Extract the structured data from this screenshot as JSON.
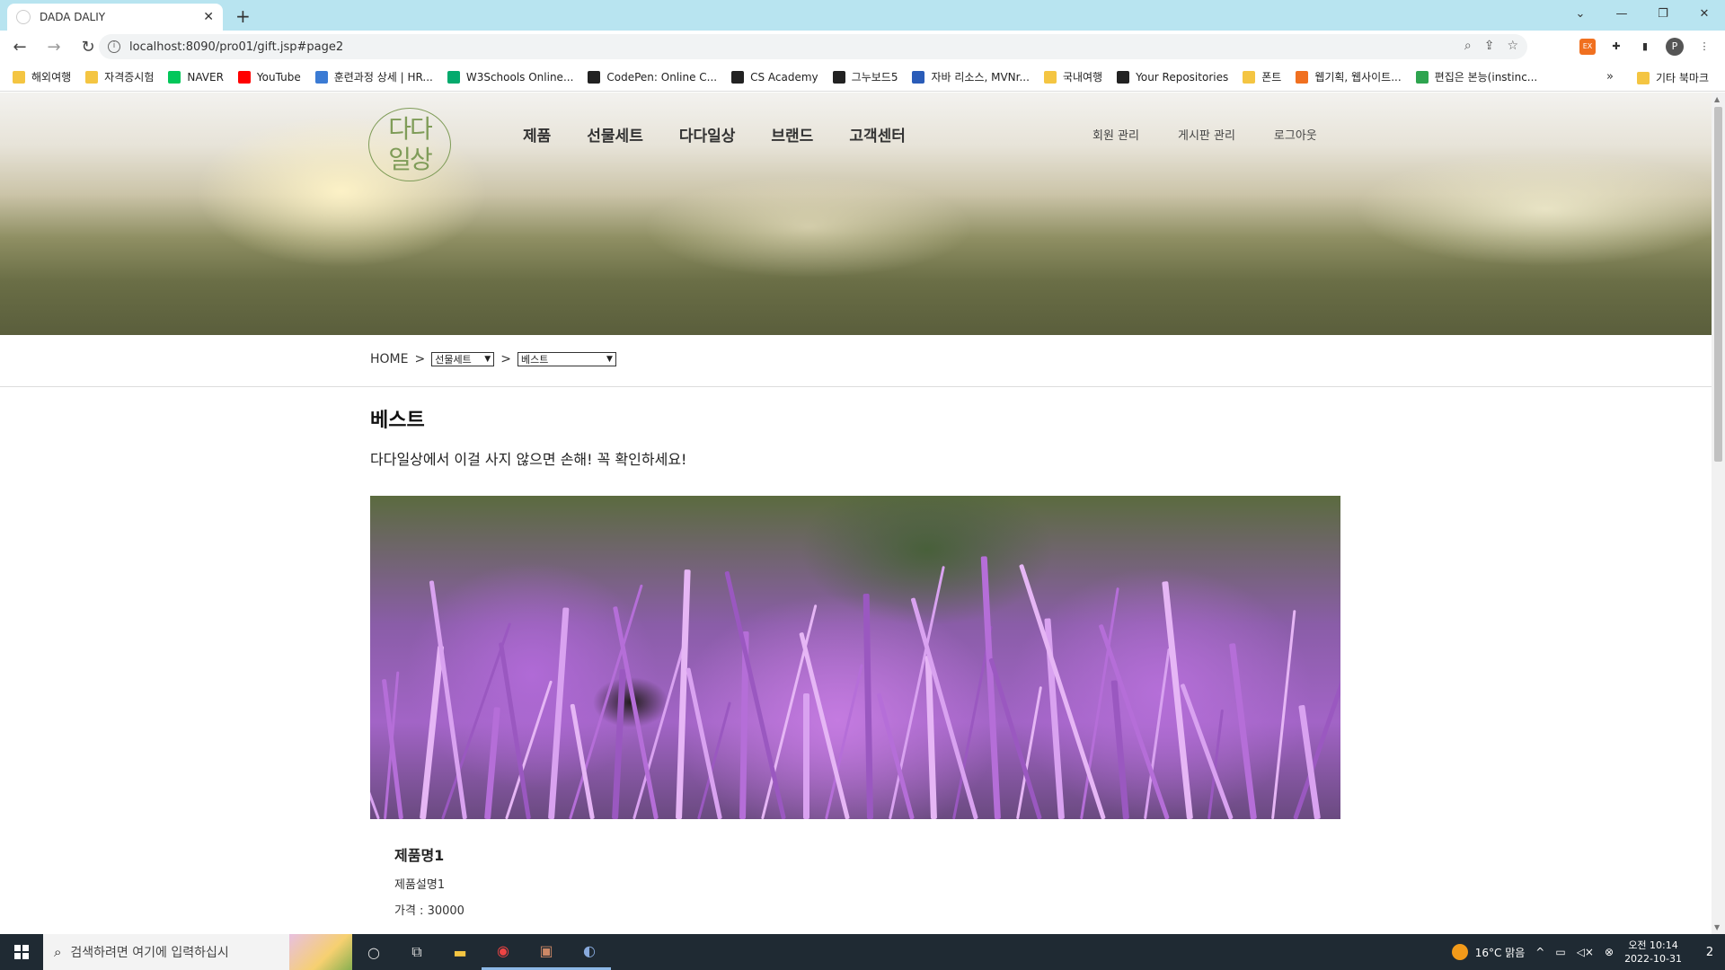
{
  "browser": {
    "tab_title": "DADA DALIY",
    "new_tab": "+",
    "url": "localhost:8090/pro01/gift.jsp#page2",
    "window_controls": [
      "⌄",
      "—",
      "❐",
      "✕"
    ]
  },
  "bookmarks": [
    {
      "label": "해외여행",
      "icon_color": "#f4c542"
    },
    {
      "label": "자격증시험",
      "icon_color": "#f4c542"
    },
    {
      "label": "NAVER",
      "icon_color": "#03c75a"
    },
    {
      "label": "YouTube",
      "icon_color": "#ff0000"
    },
    {
      "label": "훈련과정 상세 | HR...",
      "icon_color": "#3b7bd4"
    },
    {
      "label": "W3Schools Online...",
      "icon_color": "#04aa6d"
    },
    {
      "label": "CodePen: Online C...",
      "icon_color": "#222222"
    },
    {
      "label": "CS Academy",
      "icon_color": "#222222"
    },
    {
      "label": "그누보드5",
      "icon_color": "#222222"
    },
    {
      "label": "자바 리소스, MVNr...",
      "icon_color": "#2a5cb8"
    },
    {
      "label": "국내여행",
      "icon_color": "#f4c542"
    },
    {
      "label": "Your Repositories",
      "icon_color": "#222222"
    },
    {
      "label": "폰트",
      "icon_color": "#f4c542"
    },
    {
      "label": "웹기획, 웹사이트...",
      "icon_color": "#f07020"
    },
    {
      "label": "편집은 본능(instinc...",
      "icon_color": "#2ea44f"
    }
  ],
  "bookmarks_more": "»",
  "bookmarks_other": "기타 북마크",
  "site": {
    "logo_text": "다다일상",
    "gnb": [
      "제품",
      "선물세트",
      "다다일상",
      "브랜드",
      "고객센터"
    ],
    "util": [
      "회원 관리",
      "게시판 관리",
      "로그아웃"
    ]
  },
  "breadcrumb": {
    "home": "HOME",
    "separator": ">",
    "category": "선물세트",
    "subcategory": "베스트"
  },
  "section": {
    "title": "베스트",
    "description": "다다일상에서 이걸 사지 않으면 손해! 꼭 확인하세요!"
  },
  "product": {
    "name": "제품명1",
    "description": "제품설명1",
    "price": "가격 : 30000"
  },
  "taskbar": {
    "search_placeholder": "검색하려면 여기에 입력하십시",
    "weather": "16°C 맑음",
    "time": "오전 10:14",
    "date": "2022-10-31",
    "notification_count": "2"
  }
}
